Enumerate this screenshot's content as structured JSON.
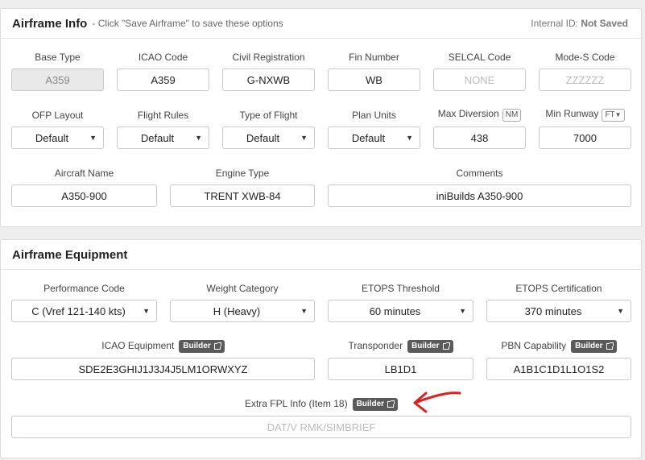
{
  "airframe_info": {
    "title": "Airframe Info",
    "hint": "- Click \"Save Airframe\" to save these options",
    "internal_id_label": "Internal ID:",
    "internal_id_value": "Not Saved",
    "base_type": {
      "label": "Base Type",
      "value": "A359"
    },
    "icao_code": {
      "label": "ICAO Code",
      "value": "A359"
    },
    "civil_registration": {
      "label": "Civil Registration",
      "value": "G-NXWB"
    },
    "fin_number": {
      "label": "Fin Number",
      "value": "WB"
    },
    "selcal_code": {
      "label": "SELCAL Code",
      "placeholder": "NONE"
    },
    "modes_code": {
      "label": "Mode-S Code",
      "placeholder": "ZZZZZZ"
    },
    "ofp_layout": {
      "label": "OFP Layout",
      "value": "Default"
    },
    "flight_rules": {
      "label": "Flight Rules",
      "value": "Default"
    },
    "type_of_flight": {
      "label": "Type of Flight",
      "value": "Default"
    },
    "plan_units": {
      "label": "Plan Units",
      "value": "Default"
    },
    "max_diversion": {
      "label": "Max Diversion",
      "unit": "NM",
      "value": "438"
    },
    "min_runway": {
      "label": "Min Runway",
      "unit": "FT",
      "value": "7000"
    },
    "aircraft_name": {
      "label": "Aircraft Name",
      "value": "A350-900"
    },
    "engine_type": {
      "label": "Engine Type",
      "value": "TRENT XWB-84"
    },
    "comments": {
      "label": "Comments",
      "value": "iniBuilds A350-900"
    }
  },
  "equipment": {
    "title": "Airframe Equipment",
    "performance_code": {
      "label": "Performance Code",
      "value": "C (Vref 121-140 kts)"
    },
    "weight_category": {
      "label": "Weight Category",
      "value": "H (Heavy)"
    },
    "etops_threshold": {
      "label": "ETOPS Threshold",
      "value": "60 minutes"
    },
    "etops_certification": {
      "label": "ETOPS Certification",
      "value": "370 minutes"
    },
    "icao_equipment": {
      "label": "ICAO Equipment",
      "value": "SDE2E3GHIJ1J3J4J5LM1ORWXYZ"
    },
    "transponder": {
      "label": "Transponder",
      "value": "LB1D1"
    },
    "pbn_capability": {
      "label": "PBN Capability",
      "value": "A1B1C1D1L1O1S2"
    },
    "extra_fpl": {
      "label": "Extra FPL Info (Item 18)",
      "placeholder": "DAT/V RMK/SIMBRIEF"
    },
    "builder_label": "Builder"
  },
  "annotation": {
    "color": "#e02020"
  }
}
